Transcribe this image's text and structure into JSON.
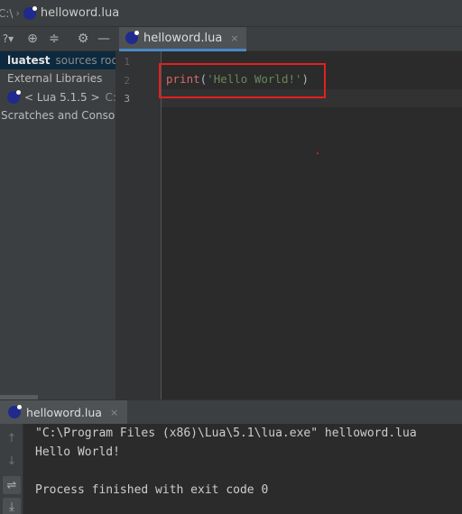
{
  "breadcrumb": {
    "tail": "C:\\",
    "file": "helloword.lua"
  },
  "project_panel": {
    "toolbar_icons": [
      "caret-question-icon",
      "locate-crosshair-icon",
      "collapse-all-icon",
      "gear-icon",
      "hide-minus-icon"
    ],
    "tree": [
      {
        "label": "luatest",
        "hint": "sources root"
      },
      {
        "label": "External Libraries"
      },
      {
        "label": "< Lua 5.1.5 >",
        "hint": "C:\\"
      },
      {
        "label": "Scratches and Consoles"
      }
    ]
  },
  "editor": {
    "tab_label": "helloword.lua",
    "tab_close": "×",
    "line_numbers": [
      "1",
      "2",
      "3"
    ],
    "code": {
      "func": "print",
      "open": "(",
      "string": "'Hello World!'",
      "close": ")"
    },
    "highlight_color": "#e51f1f"
  },
  "run_panel": {
    "tab_label": "helloword.lua",
    "tab_close": "×",
    "output": [
      "\"C:\\Program Files (x86)\\Lua\\5.1\\lua.exe\" helloword.lua",
      "Hello World!",
      "",
      "Process finished with exit code 0"
    ],
    "side_icons": [
      "up-arrow-icon",
      "down-arrow-icon",
      "soft-wrap-icon",
      "scroll-to-end-icon"
    ]
  },
  "colors": {
    "accent": "#4a88c7",
    "panel_bg": "#3c3f41",
    "editor_bg": "#2b2b2b",
    "string": "#6a8759"
  }
}
